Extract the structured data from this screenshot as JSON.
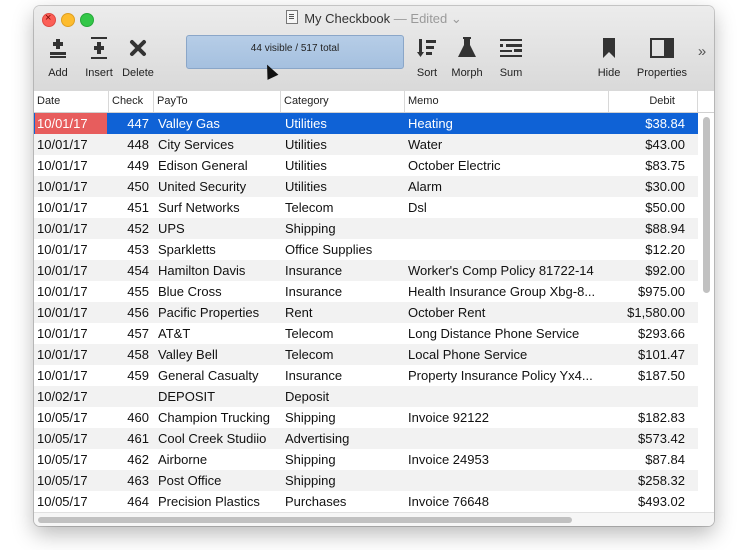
{
  "window": {
    "title": "My Checkbook",
    "edited_label": "— Edited",
    "edited_chevron": "⌄"
  },
  "toolbar": {
    "add_label": "Add",
    "insert_label": "Insert",
    "delete_label": "Delete",
    "status_text": "44 visible / 517 total",
    "sort_label": "Sort",
    "morph_label": "Morph",
    "sum_label": "Sum",
    "hide_label": "Hide",
    "properties_label": "Properties",
    "overflow_icon": "»",
    "icons": {
      "add": "add-record-icon",
      "insert": "insert-record-icon",
      "delete": "delete-record-icon",
      "sort": "sort-icon",
      "morph": "flask-icon",
      "sum": "sum-icon",
      "hide": "bookmark-icon",
      "properties": "sidebar-panel-icon"
    }
  },
  "table": {
    "columns": [
      "Date",
      "Check",
      "PayTo",
      "Category",
      "Memo",
      "Debit"
    ],
    "rows": [
      [
        "10/01/17",
        "447",
        "Valley Gas",
        "Utilities",
        "Heating",
        "$38.84"
      ],
      [
        "10/01/17",
        "448",
        "City Services",
        "Utilities",
        "Water",
        "$43.00"
      ],
      [
        "10/01/17",
        "449",
        "Edison General",
        "Utilities",
        "October Electric",
        "$83.75"
      ],
      [
        "10/01/17",
        "450",
        "United Security",
        "Utilities",
        "Alarm",
        "$30.00"
      ],
      [
        "10/01/17",
        "451",
        "Surf Networks",
        "Telecom",
        "Dsl",
        "$50.00"
      ],
      [
        "10/01/17",
        "452",
        "UPS",
        "Shipping",
        "",
        "$88.94"
      ],
      [
        "10/01/17",
        "453",
        "Sparkletts",
        "Office Supplies",
        "",
        "$12.20"
      ],
      [
        "10/01/17",
        "454",
        "Hamilton Davis",
        "Insurance",
        "Worker's Comp Policy 81722-14",
        "$92.00"
      ],
      [
        "10/01/17",
        "455",
        "Blue Cross",
        "Insurance",
        "Health Insurance Group Xbg-8...",
        "$975.00"
      ],
      [
        "10/01/17",
        "456",
        "Pacific Properties",
        "Rent",
        "October Rent",
        "$1,580.00"
      ],
      [
        "10/01/17",
        "457",
        "AT&T",
        "Telecom",
        "Long Distance Phone Service",
        "$293.66"
      ],
      [
        "10/01/17",
        "458",
        "Valley Bell",
        "Telecom",
        "Local Phone Service",
        "$101.47"
      ],
      [
        "10/01/17",
        "459",
        "General Casualty",
        "Insurance",
        "Property Insurance Policy Yx4...",
        "$187.50"
      ],
      [
        "10/02/17",
        "",
        "DEPOSIT",
        "Deposit",
        "",
        ""
      ],
      [
        "10/05/17",
        "460",
        "Champion Trucking",
        "Shipping",
        "Invoice 92122",
        "$182.83"
      ],
      [
        "10/05/17",
        "461",
        "Cool Creek Studiio",
        "Advertising",
        "",
        "$573.42"
      ],
      [
        "10/05/17",
        "462",
        "Airborne",
        "Shipping",
        "Invoice 24953",
        "$87.84"
      ],
      [
        "10/05/17",
        "463",
        "Post Office",
        "Shipping",
        "",
        "$258.32"
      ],
      [
        "10/05/17",
        "464",
        "Precision Plastics",
        "Purchases",
        "Invoice 76648",
        "$493.02"
      ]
    ],
    "selected_row": 0
  },
  "colors": {
    "selection": "#0f62d6",
    "date_highlight": "#e75d5d",
    "status_pill": "#a9c3e1"
  }
}
